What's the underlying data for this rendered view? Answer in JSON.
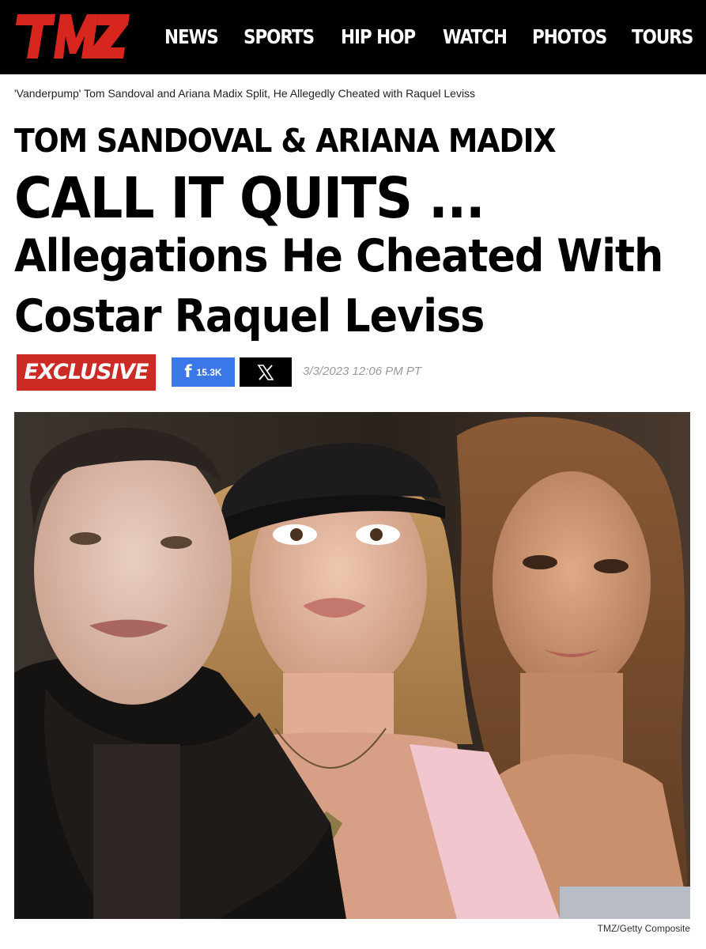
{
  "site": {
    "logo_text": "TMZ",
    "brand_color": "#d7261e"
  },
  "nav": {
    "items": [
      {
        "label": "NEWS"
      },
      {
        "label": "SPORTS"
      },
      {
        "label": "HIP HOP"
      },
      {
        "label": "WATCH"
      },
      {
        "label": "PHOTOS"
      },
      {
        "label": "TOURS"
      }
    ]
  },
  "breadcrumb": "'Vanderpump' Tom Sandoval and Ariana Madix Split, He Allegedly Cheated with Raquel Leviss",
  "headline": {
    "line1": "TOM SANDOVAL & ARIANA MADIX",
    "line2": "CALL IT QUITS ...",
    "line3": "Allegations He Cheated With",
    "line4": "Costar Raquel Leviss"
  },
  "meta": {
    "badge": "EXCLUSIVE",
    "badge_color": "#cc2a25",
    "facebook_icon": "facebook-icon",
    "facebook_count": "15.3K",
    "x_icon": "x-icon",
    "timestamp": "3/3/2023 12:06 PM PT"
  },
  "hero": {
    "caption": "TMZ/Getty Composite"
  }
}
